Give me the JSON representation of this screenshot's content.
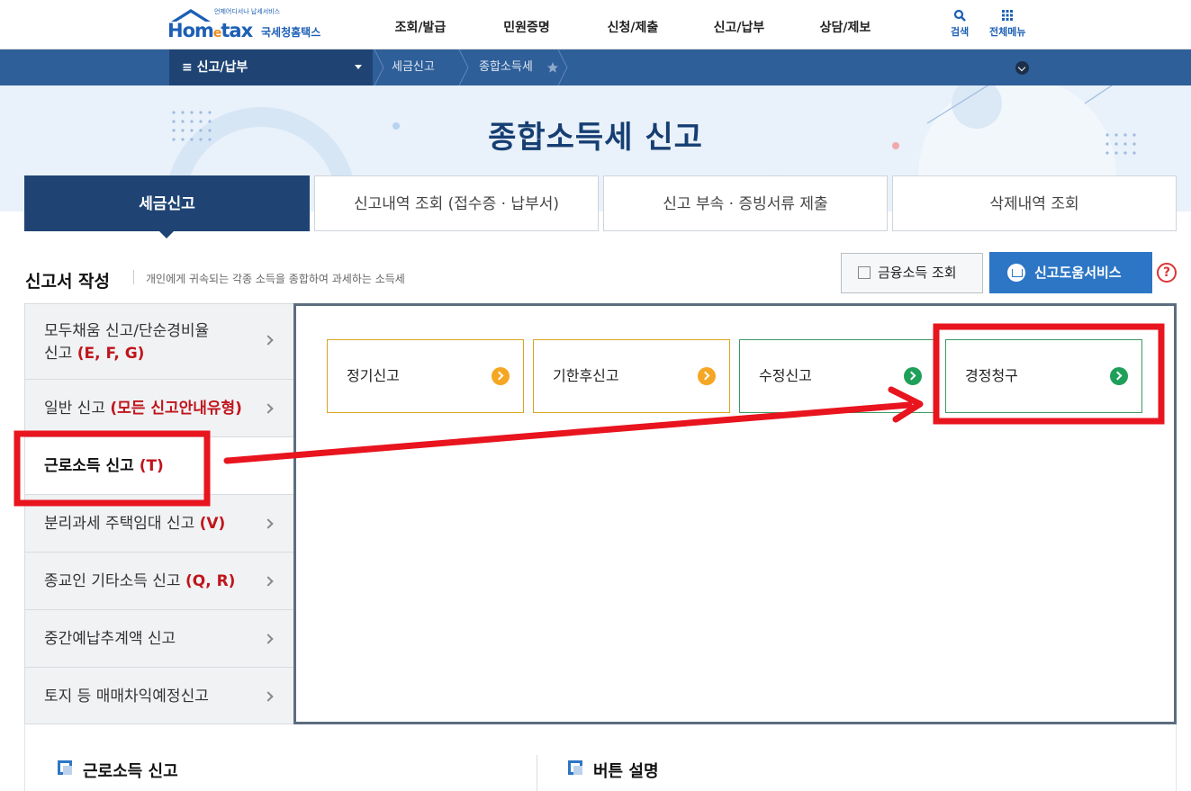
{
  "header": {
    "logo_tagline": "언제어디서나 납세서비스",
    "logo_brand_a": "Hom",
    "logo_brand_e": "e",
    "logo_brand_b": "tax",
    "logo_korean": "국세청홈택스",
    "nav": [
      "조회/발급",
      "민원증명",
      "신청/제출",
      "신고/납부",
      "상담/제보"
    ],
    "search_label": "검색",
    "allmenu_label": "전체메뉴"
  },
  "breadcrumb": {
    "menu_label": "≡ 신고/납부",
    "items": [
      "세금신고",
      "종합소득세"
    ]
  },
  "hero": {
    "title": "종합소득세 신고"
  },
  "tabs": [
    "세금신고",
    "신고내역 조회 (접수증 · 납부서)",
    "신고 부속 · 증빙서류 제출",
    "삭제내역 조회"
  ],
  "section": {
    "title": "신고서 작성",
    "desc": "개인에게 귀속되는 각종 소득을 종합하여 과세하는 소득세",
    "fin_button": "금융소득 조회",
    "help_button": "신고도움서비스",
    "help_icon": "?"
  },
  "side_menu": [
    {
      "label_line1": "모두채움 신고/단순경비율",
      "label_line2": "신고 ",
      "code": "(E, F, G)"
    },
    {
      "label": "일반 신고 ",
      "code": "(모든 신고안내유형)"
    },
    {
      "label": "근로소득 신고 ",
      "code": "(T)"
    },
    {
      "label": "분리과세 주택임대 신고 ",
      "code": "(V)"
    },
    {
      "label": "종교인 기타소득 신고 ",
      "code": "(Q, R)"
    },
    {
      "label": "중간예납추계액 신고",
      "code": ""
    },
    {
      "label": "토지 등 매매차익예정신고",
      "code": ""
    }
  ],
  "cards": [
    "정기신고",
    "기한후신고",
    "수정신고",
    "경정청구"
  ],
  "bottom": {
    "left_title": "근로소득 신고",
    "right_title": "버튼 설명"
  },
  "colors": {
    "navy": "#1f4474",
    "blue": "#2d76c6",
    "gold": "#d8a520",
    "green": "#1fa05a",
    "annotation_red": "#e8141e"
  }
}
